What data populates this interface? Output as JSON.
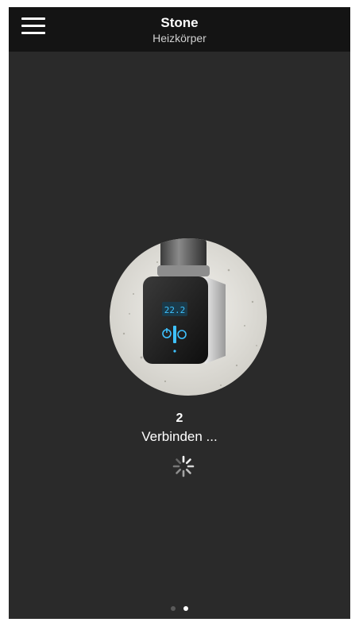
{
  "header": {
    "title": "Stone",
    "subtitle": "Heizkörper"
  },
  "main": {
    "image_alt": "Heizstab-Regler mit Display",
    "display_reading": "22.2",
    "count": "2",
    "status": "Verbinden ..."
  },
  "pager": {
    "current_page": 2,
    "total_pages": 2
  },
  "colors": {
    "background": "#2a2a2a",
    "header": "#141414",
    "text": "#ffffff",
    "accent_display": "#3ec2ff",
    "dot_active": "#ffffff",
    "dot_inactive": "#5a5a5a"
  }
}
